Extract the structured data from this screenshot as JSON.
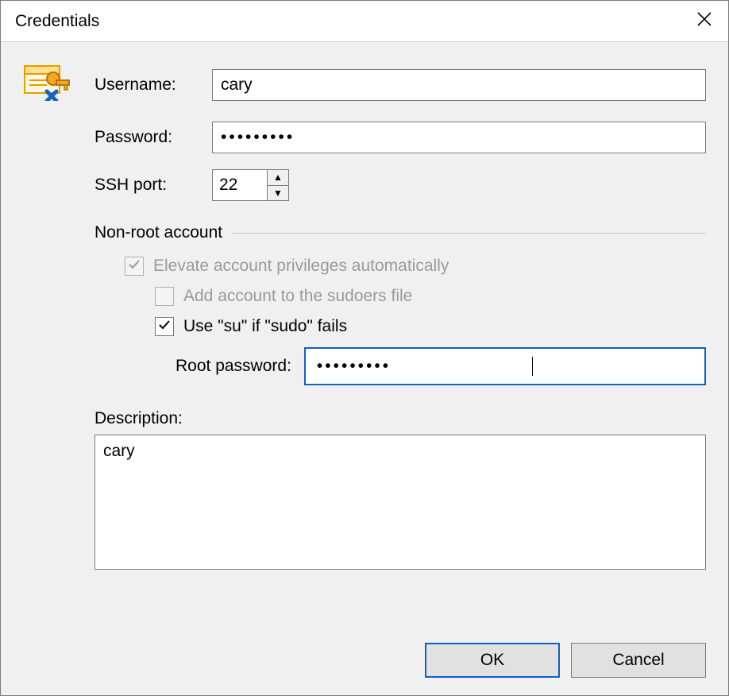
{
  "window": {
    "title": "Credentials"
  },
  "fields": {
    "username_label": "Username:",
    "username_value": "cary",
    "password_label": "Password:",
    "password_mask": "•••••••••",
    "ssh_port_label": "SSH port:",
    "ssh_port_value": "22"
  },
  "group": {
    "title": "Non-root account",
    "elevate": {
      "label": "Elevate account privileges automatically",
      "checked": true,
      "enabled": false
    },
    "sudoers": {
      "label": "Add account to the sudoers file",
      "checked": false,
      "enabled": false
    },
    "use_su": {
      "label": "Use \"su\" if \"sudo\" fails",
      "checked": true,
      "enabled": true
    },
    "root_password_label": "Root password:",
    "root_password_mask": "•••••••••"
  },
  "description": {
    "label": "Description:",
    "value": "cary"
  },
  "buttons": {
    "ok": "OK",
    "cancel": "Cancel"
  },
  "colors": {
    "focus_border": "#0a64c2",
    "panel_bg": "#f0f0f0",
    "border": "#7a7a7a",
    "disabled_text": "#9a9a9a"
  }
}
